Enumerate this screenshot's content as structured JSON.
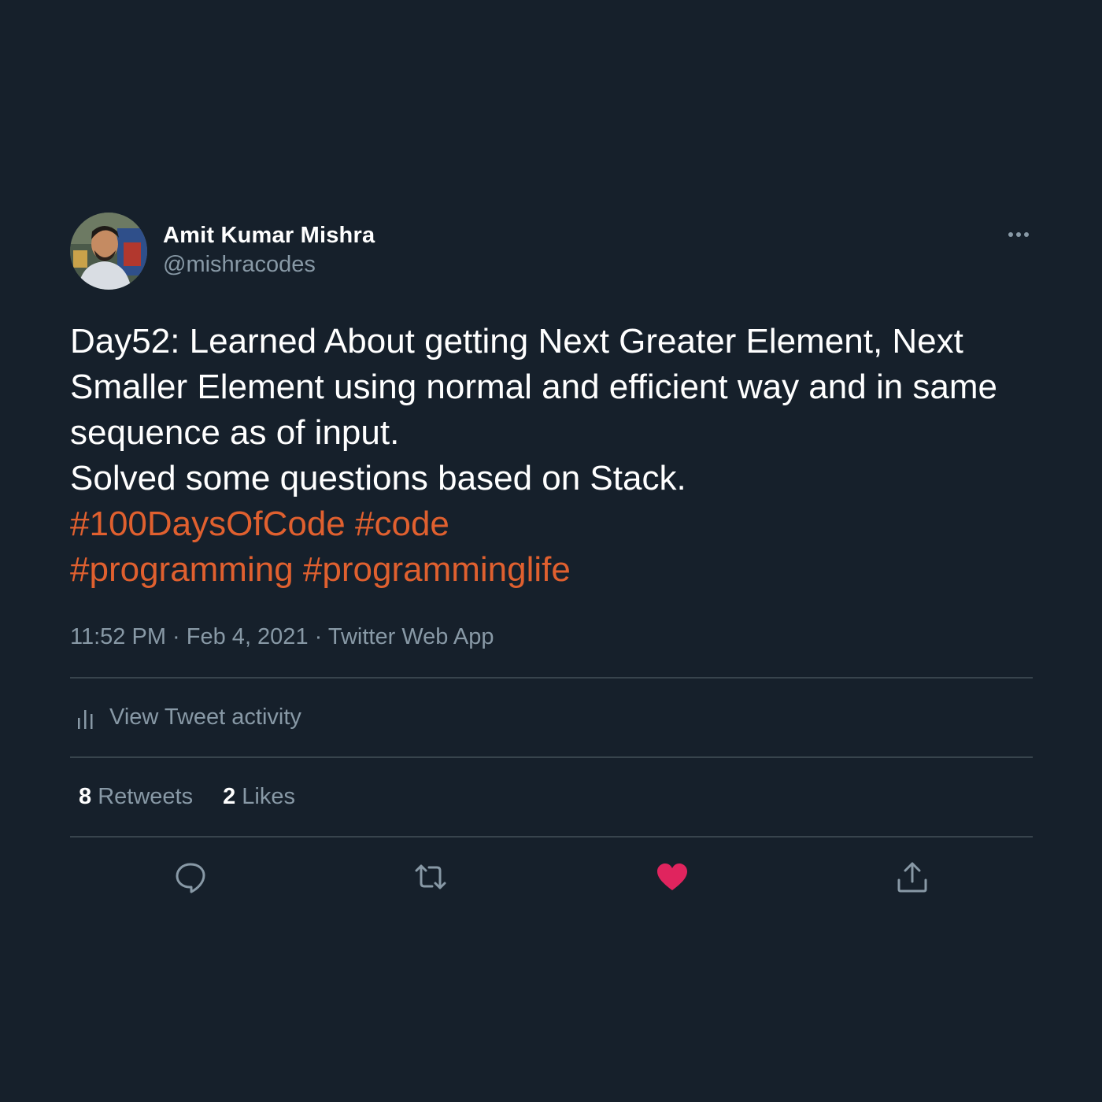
{
  "author": {
    "name": "Amit Kumar Mishra",
    "handle": "@mishracodes"
  },
  "tweet": {
    "lines": [
      "Day52: Learned About getting Next Greater Element, Next",
      "Smaller Element using normal and efficient way and in same",
      "sequence as of input.",
      "Solved some questions based on Stack."
    ],
    "hashtag_lines": [
      [
        "#100DaysOfCode",
        "#code"
      ],
      [
        "#programming",
        "#programminglife"
      ]
    ],
    "time": "11:52 PM",
    "date": "Feb 4, 2021",
    "source": "Twitter Web App",
    "separator": "·"
  },
  "activity": {
    "label": "View Tweet activity",
    "icon": "bar-chart-icon"
  },
  "stats": {
    "retweets_count": "8",
    "retweets_label": "Retweets",
    "likes_count": "2",
    "likes_label": "Likes"
  },
  "actions": {
    "reply_icon": "reply-icon",
    "retweet_icon": "retweet-icon",
    "like_icon": "heart-icon",
    "share_icon": "share-icon"
  },
  "colors": {
    "background": "#16202b",
    "hashtag": "#e0602f",
    "secondary_text": "#8899a6",
    "divider": "#38444d",
    "liked": "#e0245e"
  }
}
